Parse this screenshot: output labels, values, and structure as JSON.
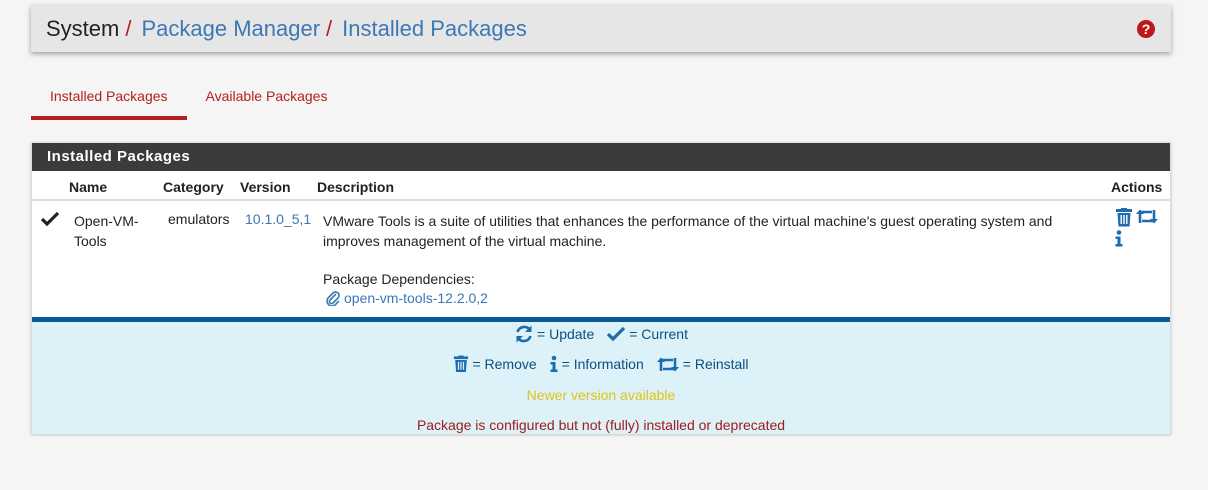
{
  "breadcrumb": {
    "root": "System",
    "separator": "/",
    "level1": "Package Manager",
    "level2": "Installed Packages",
    "help_icon": "question-circle-icon"
  },
  "tabs": [
    {
      "label": "Installed Packages",
      "active": true
    },
    {
      "label": "Available Packages",
      "active": false
    }
  ],
  "panel": {
    "title": "Installed Packages",
    "columns": [
      "Name",
      "Category",
      "Version",
      "Description",
      "Actions"
    ],
    "rows": [
      {
        "status_icon": "check-icon",
        "name": "Open-VM-Tools",
        "category": "emulators",
        "version": "10.1.0_5,1",
        "description": "VMware Tools is a suite of utilities that enhances the performance of the virtual machine's guest operating system and improves management of the virtual machine.",
        "dependencies_label": "Package Dependencies:",
        "dependency": "open-vm-tools-12.2.0,2",
        "actions": [
          "trash-icon",
          "retweet-icon",
          "info-icon"
        ]
      }
    ]
  },
  "legend": {
    "update": "= Update",
    "current": "= Current",
    "remove": "= Remove",
    "information": "= Information",
    "reinstall": "= Reinstall",
    "newer": "Newer version available",
    "deprecated": "Package is configured but not (fully) installed or deprecated"
  },
  "colors": {
    "accent_red": "#b41f1f",
    "link_blue": "#3b78b5",
    "legend_bg": "#dcf2f8",
    "newer_yellow": "#e0c21a"
  }
}
